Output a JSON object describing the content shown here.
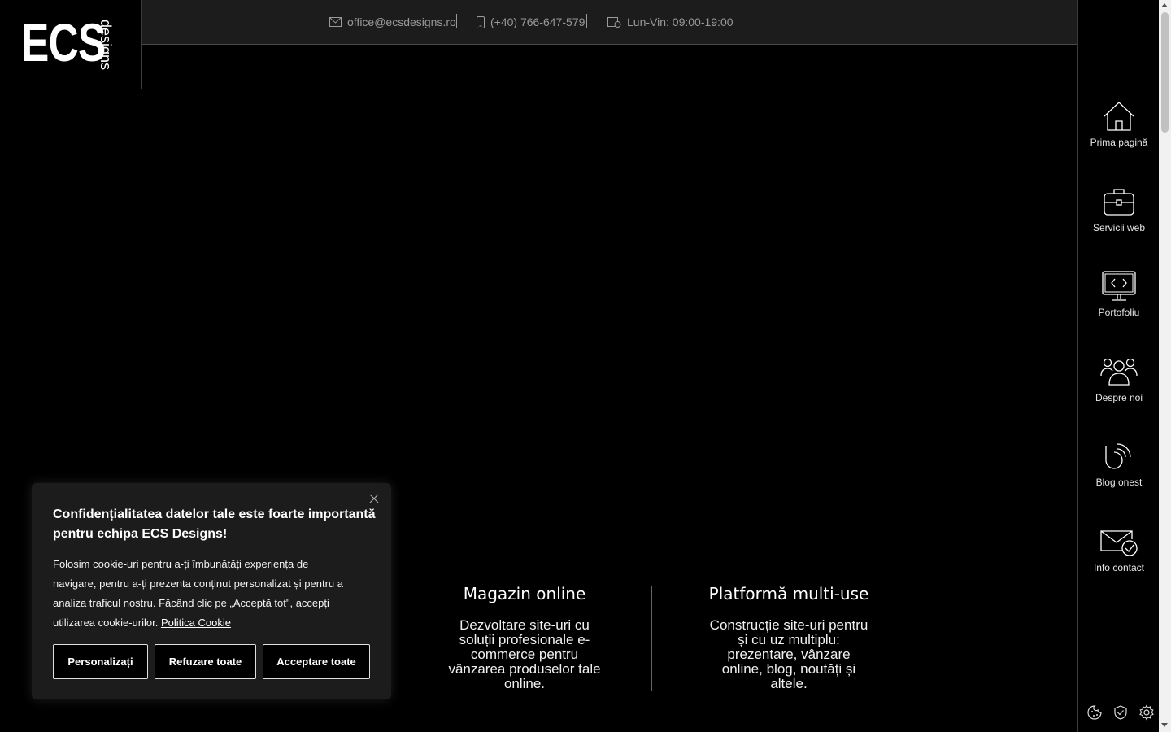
{
  "logo": {
    "main": "ECS",
    "sub": "designs"
  },
  "topbar": {
    "email": "office@ecsdesigns.ro",
    "phone": "(+40) 766-647-579",
    "hours": "Lun-Vin: 09:00-19:00"
  },
  "sidebar": {
    "items": [
      {
        "label": "Prima pagină",
        "icon": "home-icon"
      },
      {
        "label": "Servicii web",
        "icon": "briefcase-icon"
      },
      {
        "label": "Portofoliu",
        "icon": "monitor-code-icon"
      },
      {
        "label": "Despre noi",
        "icon": "users-icon"
      },
      {
        "label": "Blog onest",
        "icon": "blog-feed-icon"
      },
      {
        "label": "Info contact",
        "icon": "mail-check-icon"
      }
    ],
    "bottom_icons": [
      "cookie-icon",
      "shield-check-icon",
      "gear-icon"
    ]
  },
  "features": [
    {
      "title": "Magazin online",
      "text": "Dezvoltare site-uri cu soluții profesionale e-commerce pentru vânzarea produselor tale online."
    },
    {
      "title": "Platformă multi-use",
      "text": "Construcție site-uri pentru și cu uz multiplu: prezentare, vânzare online, blog, noutăți și altele."
    }
  ],
  "cookie": {
    "title": "Confidențialitatea datelor tale este foarte importantă pentru echipa ECS Designs!",
    "text": "Folosim cookie-uri pentru a-ți îmbunătăți experiența de navigare, pentru a-ți prezenta conținut personalizat și pentru a analiza traficul nostru. Făcând clic pe „Acceptă tot\", accepți utilizarea cookie-urilor.",
    "link": "Politica Cookie",
    "buttons": {
      "customize": "Personalizați",
      "reject": "Refuzare toate",
      "accept": "Acceptare toate"
    }
  }
}
